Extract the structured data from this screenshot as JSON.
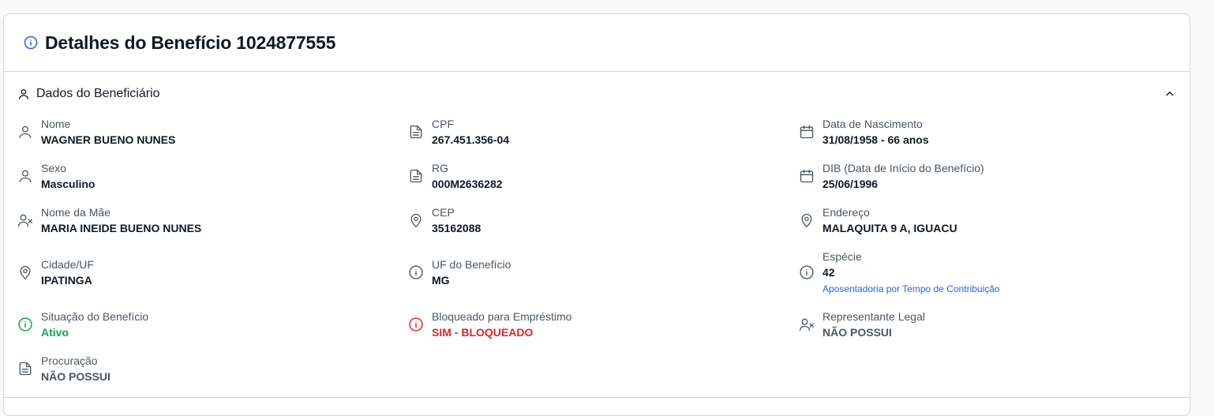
{
  "header": {
    "title": "Detalhes do Benefício 1024877555"
  },
  "section": {
    "title": "Dados do Beneficiário"
  },
  "fields": {
    "nome": {
      "label": "Nome",
      "value": "WAGNER BUENO NUNES"
    },
    "cpf": {
      "label": "CPF",
      "value": "267.451.356-04"
    },
    "nascimento": {
      "label": "Data de Nascimento",
      "value": "31/08/1958 - 66 anos"
    },
    "sexo": {
      "label": "Sexo",
      "value": "Masculino"
    },
    "rg": {
      "label": "RG",
      "value": "000M2636282"
    },
    "dib": {
      "label": "DIB (Data de Início do Benefício)",
      "value": "25/06/1996"
    },
    "mae": {
      "label": "Nome da Mãe",
      "value": "MARIA INEIDE BUENO NUNES"
    },
    "cep": {
      "label": "CEP",
      "value": "35162088"
    },
    "endereco": {
      "label": "Endereço",
      "value": "MALAQUITA 9 A, IGUACU"
    },
    "cidade": {
      "label": "Cidade/UF",
      "value": "IPATINGA"
    },
    "uf_beneficio": {
      "label": "UF do Benefício",
      "value": "MG"
    },
    "especie": {
      "label": "Espécie",
      "value": "42",
      "description": "Aposentadoria por Tempo de Contribuição"
    },
    "situacao": {
      "label": "Situação do Benefício",
      "value": "Ativo"
    },
    "bloqueado": {
      "label": "Bloqueado para Empréstimo",
      "value": "SIM - BLOQUEADO"
    },
    "representante": {
      "label": "Representante Legal",
      "value": "NÃO POSSUI"
    },
    "procuracao": {
      "label": "Procuração",
      "value": "NÃO POSSUI"
    }
  },
  "colors": {
    "info_blue": "#2563eb",
    "success_green": "#16a34a",
    "danger_red": "#dc2626",
    "icon_gray": "#4b5563"
  },
  "icons": {
    "header": "info-icon",
    "section": "user-icon",
    "collapse": "chevron-up-icon",
    "person": "user-icon",
    "document": "file-text-icon",
    "calendar": "calendar-icon",
    "user_x": "user-x-icon",
    "location": "map-pin-icon",
    "info": "info-icon"
  }
}
